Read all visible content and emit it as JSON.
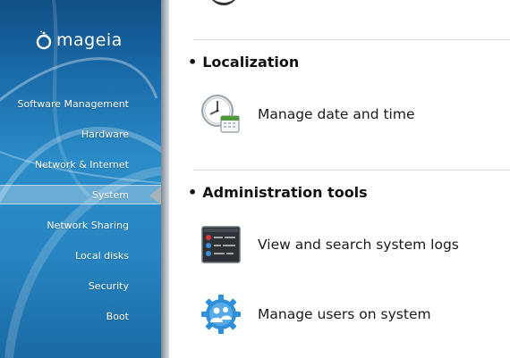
{
  "sidebar": {
    "logo": {
      "text": "mageia"
    },
    "items": [
      {
        "label": "Software Management",
        "selected": false
      },
      {
        "label": "Hardware",
        "selected": false
      },
      {
        "label": "Network & Internet",
        "selected": false
      },
      {
        "label": "System",
        "selected": true
      },
      {
        "label": "Network Sharing",
        "selected": false
      },
      {
        "label": "Local disks",
        "selected": false
      },
      {
        "label": "Security",
        "selected": false
      },
      {
        "label": "Boot",
        "selected": false
      }
    ]
  },
  "main": {
    "sections": [
      {
        "title": "Localization",
        "entries": [
          {
            "label": "Manage date and time",
            "icon": "clock-calendar-icon"
          }
        ]
      },
      {
        "title": "Administration tools",
        "entries": [
          {
            "label": "View and search system logs",
            "icon": "system-logs-icon"
          },
          {
            "label": "Manage users on system",
            "icon": "users-gear-icon"
          }
        ]
      }
    ]
  },
  "colors": {
    "sidebar_blue": "#1a6aa8",
    "accent_blue": "#2f8fd8",
    "text": "#1a1a1a"
  }
}
